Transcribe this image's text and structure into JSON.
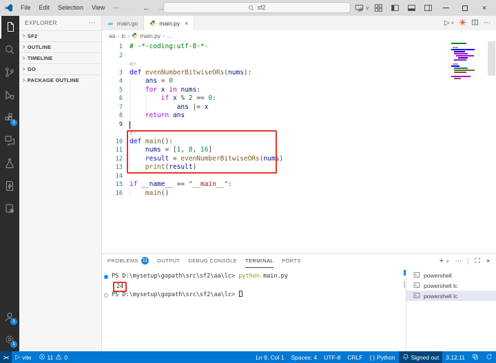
{
  "colors": {
    "accent": "#0078d4",
    "annotation": "#e8312a",
    "badge": "#1f86d6"
  },
  "titlebar": {
    "menus": [
      "File",
      "Edit",
      "Selection",
      "View"
    ],
    "overflow_label": "⋯",
    "search_value": "sf2"
  },
  "activity_bar": {
    "top": [
      {
        "icon": "files",
        "name": "explorer",
        "active": true
      },
      {
        "icon": "search",
        "name": "search"
      },
      {
        "icon": "source-control",
        "name": "source-control"
      },
      {
        "icon": "run-debug",
        "name": "run-and-debug"
      },
      {
        "icon": "extensions",
        "name": "extensions",
        "badge": "1"
      },
      {
        "icon": "chat",
        "name": "chat"
      },
      {
        "icon": "testing",
        "name": "testing"
      },
      {
        "icon": "snippets",
        "name": "snippets"
      },
      {
        "icon": "tools",
        "name": "code-tools"
      }
    ],
    "bottom": [
      {
        "icon": "account",
        "name": "accounts",
        "badge": "1"
      },
      {
        "icon": "gear",
        "name": "settings",
        "badge": "1"
      }
    ]
  },
  "sidebar": {
    "title": "EXPLORER",
    "more_label": "⋯",
    "sections": [
      {
        "label": "SF2"
      },
      {
        "label": "OUTLINE"
      },
      {
        "label": "TIMELINE"
      },
      {
        "label": "GO"
      },
      {
        "label": "PACKAGE OUTLINE"
      }
    ]
  },
  "editor": {
    "tabs": [
      {
        "label": "main.go",
        "icon": "go",
        "active": false
      },
      {
        "label": "main.py",
        "icon": "python",
        "active": true
      }
    ],
    "breadcrumb": [
      {
        "label": "aa"
      },
      {
        "label": "lc"
      },
      {
        "label": "main.py",
        "icon": "python"
      },
      {
        "label": "..."
      }
    ],
    "rows": [
      {
        "type": "code",
        "num": "1",
        "tokens": [
          [
            "# -*-coding:utf-8-*-",
            "c"
          ]
        ]
      },
      {
        "type": "code",
        "num": "2",
        "tokens": []
      },
      {
        "type": "deco"
      },
      {
        "type": "code",
        "num": "3",
        "tokens": [
          [
            "def",
            "k"
          ],
          [
            " ",
            "p"
          ],
          [
            "evenNumberBitwiseORs",
            "f"
          ],
          [
            "(",
            "p"
          ],
          [
            "nums",
            "v"
          ],
          [
            "):",
            "p"
          ]
        ]
      },
      {
        "type": "code",
        "num": "4",
        "g": 1,
        "tokens": [
          [
            "    ",
            "p"
          ],
          [
            "ans",
            "v"
          ],
          [
            " = ",
            "p"
          ],
          [
            "0",
            "n"
          ]
        ]
      },
      {
        "type": "code",
        "num": "5",
        "g": 1,
        "tokens": [
          [
            "    ",
            "p"
          ],
          [
            "for",
            "ctl"
          ],
          [
            " ",
            "p"
          ],
          [
            "x",
            "v"
          ],
          [
            " ",
            "p"
          ],
          [
            "in",
            "ctl"
          ],
          [
            " ",
            "p"
          ],
          [
            "nums",
            "v"
          ],
          [
            ":",
            "p"
          ]
        ]
      },
      {
        "type": "code",
        "num": "6",
        "g": 2,
        "tokens": [
          [
            "        ",
            "p"
          ],
          [
            "if",
            "ctl"
          ],
          [
            " ",
            "p"
          ],
          [
            "x",
            "v"
          ],
          [
            " % ",
            "p"
          ],
          [
            "2",
            "n"
          ],
          [
            " == ",
            "p"
          ],
          [
            "0",
            "n"
          ],
          [
            ":",
            "p"
          ]
        ]
      },
      {
        "type": "code",
        "num": "7",
        "g": 2,
        "tokens": [
          [
            "            ",
            "p"
          ],
          [
            "ans",
            "v"
          ],
          [
            " |= ",
            "p"
          ],
          [
            "x",
            "v"
          ]
        ]
      },
      {
        "type": "code",
        "num": "8",
        "g": 1,
        "tokens": [
          [
            "    ",
            "p"
          ],
          [
            "return",
            "ctl"
          ],
          [
            " ",
            "p"
          ],
          [
            "ans",
            "v"
          ]
        ]
      },
      {
        "type": "code",
        "num": "9",
        "cursor": true,
        "active": true,
        "tokens": []
      },
      {
        "type": "deco"
      },
      {
        "type": "code",
        "num": "10",
        "tokens": [
          [
            "def",
            "k"
          ],
          [
            " ",
            "p"
          ],
          [
            "main",
            "f"
          ],
          [
            "():",
            "p"
          ]
        ]
      },
      {
        "type": "code",
        "num": "11",
        "g": 1,
        "tokens": [
          [
            "    ",
            "p"
          ],
          [
            "nums",
            "v"
          ],
          [
            " = [",
            "p"
          ],
          [
            "1",
            "n"
          ],
          [
            ", ",
            "p"
          ],
          [
            "8",
            "n"
          ],
          [
            ", ",
            "p"
          ],
          [
            "16",
            "n"
          ],
          [
            "]",
            "p"
          ]
        ]
      },
      {
        "type": "code",
        "num": "12",
        "g": 1,
        "tokens": [
          [
            "    ",
            "p"
          ],
          [
            "result",
            "v"
          ],
          [
            " = ",
            "p"
          ],
          [
            "evenNumberBitwiseORs",
            "f"
          ],
          [
            "(",
            "p"
          ],
          [
            "nums",
            "v"
          ],
          [
            ")",
            "p"
          ]
        ]
      },
      {
        "type": "code",
        "num": "13",
        "g": 1,
        "tokens": [
          [
            "    ",
            "p"
          ],
          [
            "print",
            "f"
          ],
          [
            "(",
            "p"
          ],
          [
            "result",
            "v"
          ],
          [
            ")",
            "p"
          ]
        ]
      },
      {
        "type": "code",
        "num": "14",
        "tokens": []
      },
      {
        "type": "code",
        "num": "15",
        "tokens": [
          [
            "if",
            "ctl"
          ],
          [
            " ",
            "p"
          ],
          [
            "__name__",
            "v"
          ],
          [
            " == ",
            "p"
          ],
          [
            "\"__main__\"",
            "s"
          ],
          [
            ":",
            "p"
          ]
        ]
      },
      {
        "type": "code",
        "num": "16",
        "g": 1,
        "tokens": [
          [
            "    ",
            "p"
          ],
          [
            "main",
            "f"
          ],
          [
            "()",
            "p"
          ]
        ]
      }
    ],
    "annotation_rows": {
      "from": 10,
      "to": 14
    }
  },
  "panel": {
    "tabs": [
      {
        "label": "PROBLEMS",
        "badge": "11"
      },
      {
        "label": "OUTPUT"
      },
      {
        "label": "DEBUG CONSOLE"
      },
      {
        "label": "TERMINAL",
        "active": true
      },
      {
        "label": "PORTS"
      }
    ],
    "terminal": {
      "rows": [
        {
          "deco": "filled",
          "tokens": [
            [
              "PS D:\\mysetup\\gopath\\src\\sf2\\aa\\lc> ",
              "t"
            ],
            [
              "python",
              "y"
            ],
            [
              " main.py",
              "t"
            ]
          ]
        },
        {
          "boxed": "24"
        },
        {
          "deco": "hollow",
          "cursor": true,
          "tokens": [
            [
              "PS D:\\mysetup\\gopath\\src\\sf2\\aa\\lc> ",
              "t"
            ]
          ]
        }
      ]
    },
    "terminal_list": [
      {
        "label": "powershell"
      },
      {
        "label": "powershell lc"
      },
      {
        "label": "powershell lc",
        "selected": true
      }
    ]
  },
  "status_bar": {
    "left": [
      {
        "name": "remote",
        "icon": "remote",
        "dark": true
      },
      {
        "name": "vite-task",
        "icon": "play",
        "label": "vite"
      },
      {
        "name": "problems",
        "parts": [
          {
            "icon": "error",
            "label": "11"
          },
          {
            "icon": "warning",
            "label": "0"
          }
        ]
      }
    ],
    "right": [
      {
        "name": "cursor-position",
        "label": "Ln 9, Col 1"
      },
      {
        "name": "indentation",
        "label": "Spaces: 4"
      },
      {
        "name": "encoding",
        "label": "UTF-8"
      },
      {
        "name": "eol",
        "label": "CRLF"
      },
      {
        "name": "language-mode",
        "icon": "braces",
        "label": "Python"
      },
      {
        "name": "account-status",
        "icon": "bell",
        "label": "Signed out",
        "dark": true
      },
      {
        "name": "python-version",
        "label": "3.12.11"
      },
      {
        "name": "python-env",
        "icon": "layers"
      },
      {
        "name": "notifications",
        "icon": "sync"
      }
    ]
  }
}
